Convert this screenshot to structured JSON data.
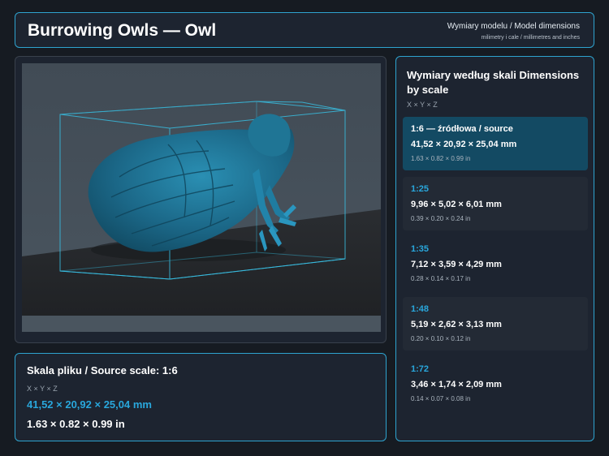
{
  "header": {
    "title": "Burrowing Owls — Owl",
    "dims_title": "Wymiary modelu / Model dimensions",
    "dims_subtitle": "milimetry i cale / millimetres and inches"
  },
  "viewer": {
    "model_name": "owl-model"
  },
  "source": {
    "title": "Skala pliku / Source scale: 1:6",
    "axis": "X × Y × Z",
    "mm": "41,52 × 20,92 × 25,04 mm",
    "inches": "1.63 × 0.82 × 0.99 in"
  },
  "scales": {
    "title": "Wymiary według skali Dimensions by scale",
    "axis": "X × Y × Z",
    "items": [
      {
        "label": "1:6  —  źródłowa / source",
        "mm": "41,52 × 20,92 × 25,04 mm",
        "inches": "1.63 × 0.82 × 0.99 in"
      },
      {
        "label": "1:25",
        "mm": "9,96 × 5,02 × 6,01 mm",
        "inches": "0.39 × 0.20 × 0.24 in"
      },
      {
        "label": "1:35",
        "mm": "7,12 × 3,59 × 4,29 mm",
        "inches": "0.28 × 0.14 × 0.17 in"
      },
      {
        "label": "1:48",
        "mm": "5,19 × 2,62 × 3,13 mm",
        "inches": "0.20 × 0.10 × 0.12 in"
      },
      {
        "label": "1:72",
        "mm": "3,46 × 1,74 × 2,09 mm",
        "inches": "0.14 × 0.07 × 0.08 in"
      }
    ]
  },
  "colors": {
    "accent": "#29a7dc",
    "panel": "#1d2430",
    "background": "#161b22",
    "active_item": "#134a63",
    "model": "#1e6e8e"
  }
}
